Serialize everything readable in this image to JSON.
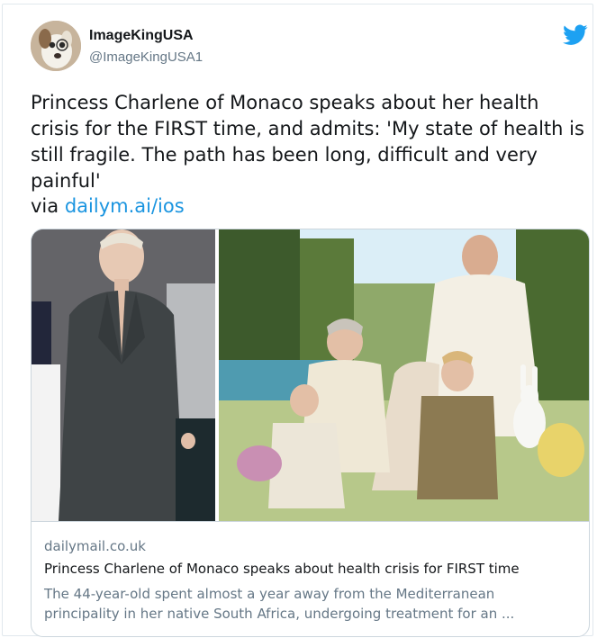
{
  "author": {
    "name": "ImageKingUSA",
    "handle": "@ImageKingUSA1",
    "avatar_icon": "dog-avatar-icon"
  },
  "brand": {
    "icon": "twitter-bird-icon",
    "color": "#1da1f2"
  },
  "tweet": {
    "text": "Princess Charlene of Monaco speaks about her health\ncrisis for the FIRST time, and admits: 'My state of health is\nstill fragile. The path has been long, difficult and very\npainful'",
    "via_prefix": "via",
    "link_text": "dailym.ai/ios",
    "link_color": "#1b95e0"
  },
  "card": {
    "domain": "dailymail.co.uk",
    "title": "Princess Charlene of Monaco speaks about health crisis for FIRST time",
    "description": "The 44-year-old spent almost a year away from the Mediterranean principality in her native South Africa, undergoing treatment for an ..."
  }
}
